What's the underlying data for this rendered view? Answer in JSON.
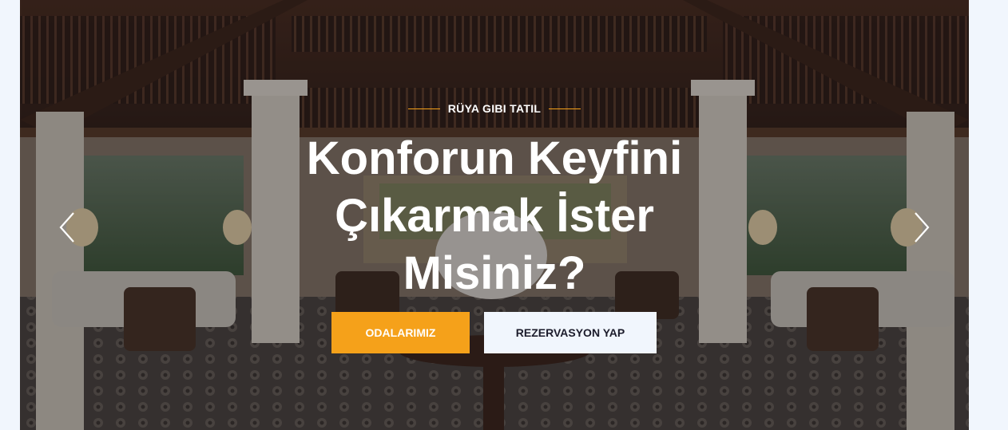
{
  "hero": {
    "eyebrow": "RÜYA GIBI TATIL",
    "headline_lines": [
      "Konforun Keyfini",
      "Çıkarmak İster",
      "Misiniz?"
    ],
    "primary_button": "ODALARIMIZ",
    "secondary_button": "REZERVASYON YAP",
    "colors": {
      "accent": "#f5a11a",
      "secondary_button_bg": "#f1f6fd",
      "page_bg": "#f1f6fd"
    }
  },
  "slider": {
    "prev_icon": "chevron-left-icon",
    "next_icon": "chevron-right-icon"
  }
}
